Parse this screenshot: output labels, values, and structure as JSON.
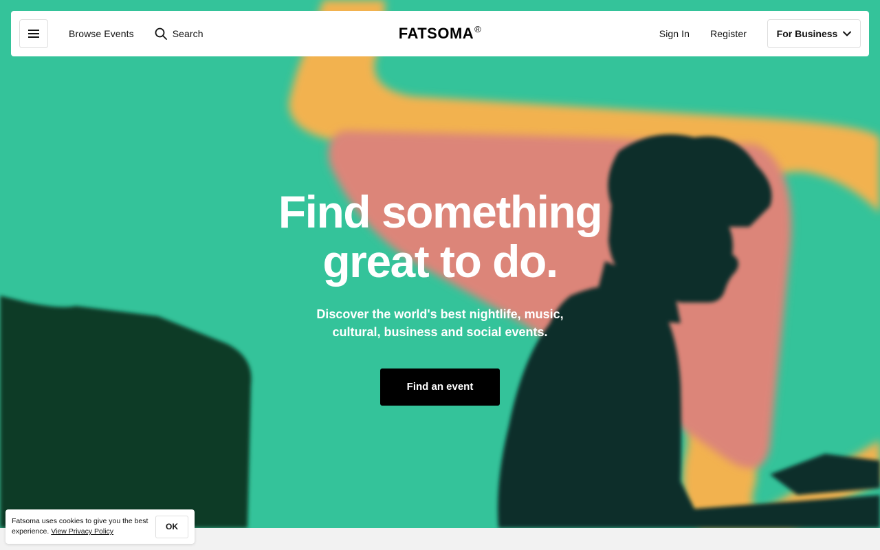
{
  "header": {
    "browse_label": "Browse Events",
    "search_label": "Search",
    "logo_text": "FATSOMA",
    "logo_mark": "®",
    "signin_label": "Sign In",
    "register_label": "Register",
    "business_label": "For Business"
  },
  "hero": {
    "title_line1": "Find something",
    "title_line2": "great to do.",
    "subtitle_line1": "Discover the world's best nightlife, music,",
    "subtitle_line2": "cultural, business and social events.",
    "cta_label": "Find an event"
  },
  "cookie": {
    "text": "Fatsoma uses cookies to give you the best experience.",
    "link_label": "View Privacy Policy",
    "ok_label": "OK"
  },
  "colors": {
    "background_green": "#34c39a",
    "shape_orange": "#f2b24f",
    "shape_pink": "#dc8579",
    "cta_black": "#000000"
  },
  "icons": {
    "menu": "hamburger-icon",
    "search": "search-icon",
    "dropdown": "chevron-down-icon"
  }
}
